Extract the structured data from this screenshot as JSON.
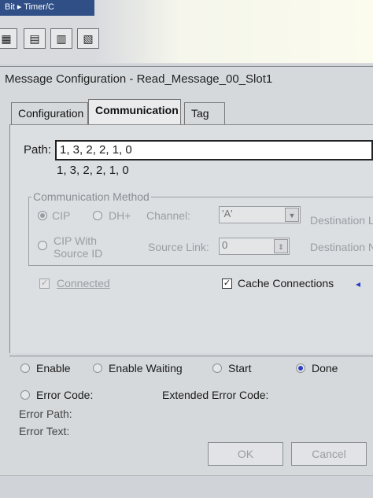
{
  "app": {
    "tab_label": "Bit ▸ Timer/C",
    "toolbar": [
      {
        "name": "toolbar-btn-1",
        "icon": "ladder-icon"
      },
      {
        "name": "toolbar-btn-2",
        "icon": "rung-icon"
      },
      {
        "name": "toolbar-btn-3",
        "icon": "branch-icon"
      },
      {
        "name": "toolbar-btn-4",
        "icon": "element-icon"
      }
    ]
  },
  "dialog": {
    "title": "Message Configuration - Read_Message_00_Slot1",
    "tabs": [
      "Configuration",
      "Communication",
      "Tag"
    ],
    "active_tab": "Communication",
    "path": {
      "label": "Path:",
      "value": "1, 3, 2, 2, 1, 0",
      "resolved": "1, 3, 2, 2, 1, 0"
    },
    "comm_method": {
      "legend": "Communication Method",
      "cip": "CIP",
      "dh_plus": "DH+",
      "channel_label": "Channel:",
      "channel_value": "'A'",
      "dest_link_label": "Destination L",
      "cip_with_source_id": [
        "CIP With",
        "Source ID"
      ],
      "source_link_label": "Source Link:",
      "source_link_value": "0",
      "dest_node_label": "Destination N"
    },
    "connected_label": "Connected",
    "cache_connections_label": "Cache Connections",
    "cache_arrow": "◂",
    "status": {
      "enable": "Enable",
      "enable_waiting": "Enable Waiting",
      "start": "Start",
      "done": "Done",
      "error_code": "Error Code:",
      "extended_error_code": "Extended Error Code:",
      "error_path": "Error Path:",
      "error_text": "Error Text:"
    },
    "buttons": {
      "ok": "OK",
      "cancel": "Cancel"
    }
  }
}
